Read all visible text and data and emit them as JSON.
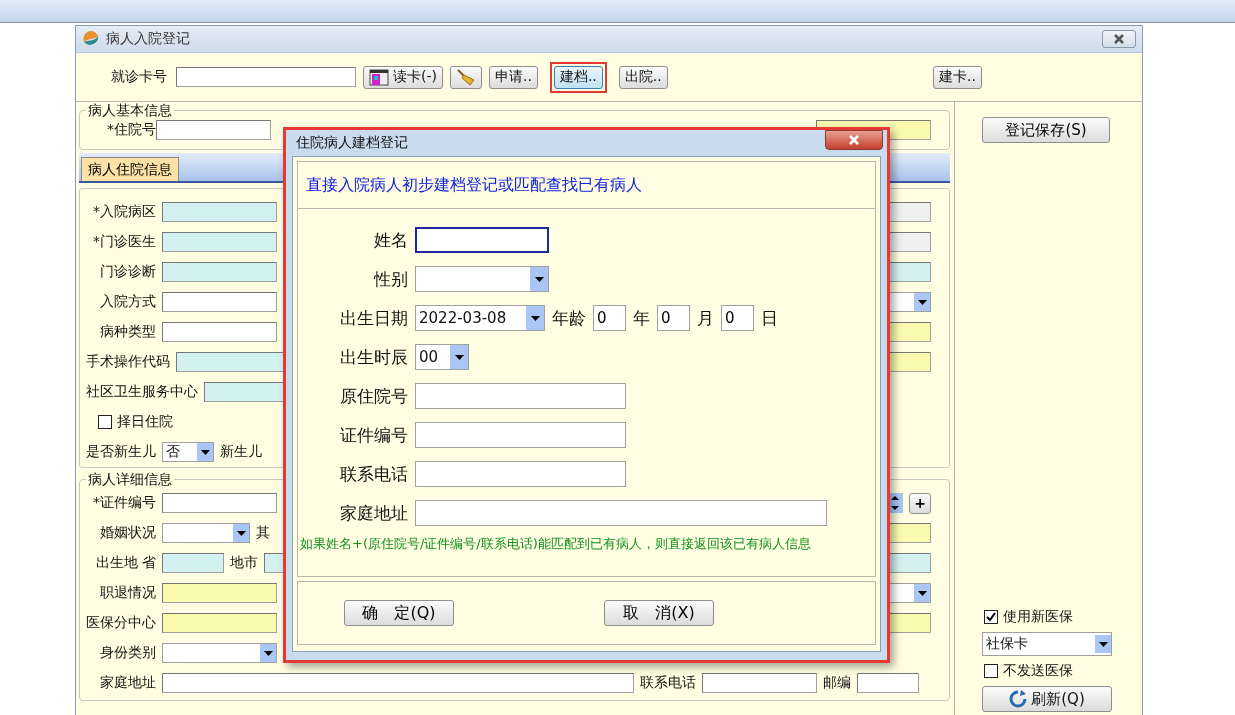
{
  "main_window": {
    "title": "病人入院登记"
  },
  "toolbar": {
    "card_label": "就诊卡号",
    "buttons": [
      {
        "kind": "card",
        "label": "读卡(-)",
        "highlighted": false
      },
      {
        "kind": "broom",
        "highlighted": false
      },
      {
        "kind": "text",
        "label": "申请..",
        "highlighted": false
      },
      {
        "kind": "text",
        "label": "建档..",
        "highlighted": true
      },
      {
        "kind": "text",
        "label": "出院..",
        "highlighted": false
      }
    ],
    "right_button": {
      "label": "建卡.."
    }
  },
  "basic_info": {
    "title": "病人基本信息",
    "fields": [
      {
        "label": "*住院号",
        "color": "#ffffff"
      },
      {
        "color": "#fbfbb0"
      }
    ]
  },
  "tabs": [
    {
      "label": "病人住院信息",
      "selected": true
    }
  ],
  "admission": {
    "rows": [
      {
        "label": "*入院病区",
        "kind": "field",
        "color": "#d3f1f1",
        "right": {
          "kind": "field",
          "color": "#f0f0f0"
        }
      },
      {
        "label": "*门诊医生",
        "kind": "field",
        "color": "#d3f1f1",
        "right": {
          "kind": "field",
          "color": "#f0f0f0"
        }
      },
      {
        "label": "门诊诊断",
        "kind": "field",
        "color": "#d3f1f1",
        "right": {
          "kind": "field",
          "color": "#d3f1f1"
        }
      },
      {
        "label": "入院方式",
        "kind": "field",
        "color": "#ffffff",
        "right": {
          "kind": "combo"
        }
      },
      {
        "label": "病种类型",
        "kind": "field",
        "color": "#ffffff",
        "right": {
          "kind": "field",
          "color": "#fbfbb0"
        }
      },
      {
        "label": "手术操作代码",
        "kind": "field",
        "color": "#d3f1f1",
        "right": {
          "kind": "field",
          "color": "#fbfbb0"
        }
      },
      {
        "label": "社区卫生服务中心",
        "kind": "field",
        "color": "#d3f1f1"
      },
      {
        "label": "择日住院",
        "kind": "checkbox",
        "checked": false
      },
      {
        "label": "是否新生儿",
        "kind": "small_combo",
        "value": "否",
        "extra": [
          {
            "kind": "label",
            "text": "新生儿"
          }
        ]
      }
    ]
  },
  "details": {
    "title": "病人详细信息",
    "rows": [
      {
        "label": "*证件编号",
        "kind": "field",
        "color": "#ffffff",
        "right": {
          "kind": "spin_plus",
          "text": "+"
        }
      },
      {
        "label": "婚姻状况",
        "kind": "combo",
        "extra": [
          {
            "kind": "label",
            "text": "其"
          }
        ],
        "right": {
          "kind": "field",
          "color": "#fbfbb0"
        }
      },
      {
        "label": "出生地 省",
        "kind": "short_field",
        "color": "#d3f1f1",
        "extra": [
          {
            "kind": "label",
            "text": "地市"
          },
          {
            "kind": "field",
            "color": "#d3f1f1"
          }
        ],
        "right": {
          "kind": "field",
          "color": "#d3f1f1"
        }
      },
      {
        "label": "职退情况",
        "kind": "field",
        "color": "#fbfbb0",
        "right": {
          "kind": "combo"
        }
      },
      {
        "label": "医保分中心",
        "kind": "field",
        "color": "#fbfbb0",
        "right": {
          "kind": "field",
          "color": "#fbfbb0"
        }
      },
      {
        "label": "身份类别",
        "kind": "wide_combo"
      },
      {
        "label": "家庭地址",
        "kind": "wide_field",
        "color": "#ffffff",
        "extra": [
          {
            "kind": "label",
            "text": "联系电话"
          },
          {
            "kind": "field",
            "color": "#ffffff"
          },
          {
            "kind": "label",
            "text": "邮编"
          },
          {
            "kind": "short_field",
            "color": "#ffffff"
          }
        ]
      }
    ]
  },
  "side_panel": {
    "save_button": "登记保存(S)",
    "options": [
      {
        "kind": "checkbox",
        "label": "使用新医保",
        "checked": true
      },
      {
        "kind": "select",
        "value": "社保卡"
      },
      {
        "kind": "checkbox",
        "label": "不发送医保",
        "checked": false
      },
      {
        "kind": "button",
        "label": "刷新(Q)"
      }
    ]
  },
  "dialog": {
    "title": "住院病人建档登记",
    "header": "直接入院病人初步建档登记或匹配查找已有病人",
    "fields": [
      {
        "label": "姓名",
        "kind": "name",
        "focused": true
      },
      {
        "label": "性别",
        "kind": "select",
        "focused": false
      },
      {
        "label": "出生日期",
        "kind": "date",
        "value": "2022-03-08",
        "focused": false,
        "age_label": "年龄",
        "age": [
          {
            "value": "0",
            "unit": "年"
          },
          {
            "value": "0",
            "unit": "月"
          },
          {
            "value": "0",
            "unit": "日"
          }
        ]
      },
      {
        "label": "出生时辰",
        "kind": "hour",
        "value": "00",
        "focused": false
      },
      {
        "label": "原住院号",
        "kind": "text",
        "focused": false
      },
      {
        "label": "证件编号",
        "kind": "text",
        "focused": false
      },
      {
        "label": "联系电话",
        "kind": "text",
        "focused": false
      },
      {
        "label": "家庭地址",
        "kind": "address",
        "focused": false
      }
    ],
    "note": "如果姓名+(原住院号/证件编号/联系电话)能匹配到已有病人，则直接返回该已有病人信息",
    "buttons": [
      {
        "label": "确　定(Q)"
      },
      {
        "label": "取　消(X)"
      }
    ]
  }
}
